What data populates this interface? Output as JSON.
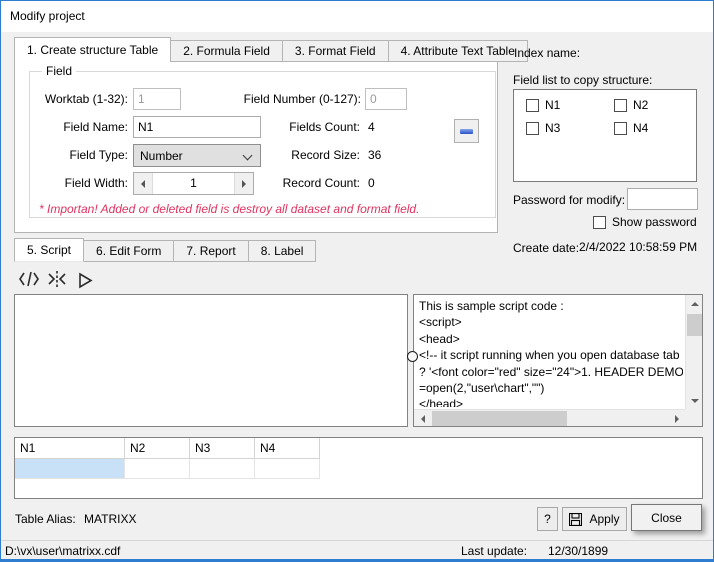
{
  "window": {
    "title": "Modify project"
  },
  "colors": {
    "accent_blue": "#2e7dd1",
    "warning_red": "#e0335f",
    "selection_blue": "#c9e1f7",
    "equals_dash_blue": "#2b50c8"
  },
  "tabs_top": {
    "items": [
      {
        "label": "1. Create structure Table",
        "active": true
      },
      {
        "label": "2. Formula Field",
        "active": false
      },
      {
        "label": "3. Format Field",
        "active": false
      },
      {
        "label": "4. Attribute Text Table",
        "active": false
      }
    ]
  },
  "field_group": {
    "legend": "Field",
    "worktab_label": "Worktab (1-32):",
    "worktab_value": "1",
    "field_number_label": "Field Number (0-127):",
    "field_number_value": "0",
    "field_name_label": "Field Name:",
    "field_name_value": "N1",
    "fields_count_label": "Fields Count:",
    "fields_count_value": "4",
    "field_type_label": "Field Type:",
    "field_type_value": "Number",
    "record_size_label": "Record Size:",
    "record_size_value": "36",
    "field_width_label": "Field Width:",
    "field_width_value": "1",
    "record_count_label": "Record Count:",
    "record_count_value": "0",
    "warning": "* Importan! Added or deleted field is destroy all dataset and format field."
  },
  "right_panel": {
    "index_name_label": "Index name:",
    "field_list_label": "Field list to copy structure:",
    "field_list": [
      {
        "label": "N1",
        "checked": false
      },
      {
        "label": "N2",
        "checked": false
      },
      {
        "label": "N3",
        "checked": false
      },
      {
        "label": "N4",
        "checked": false
      }
    ],
    "password_label": "Password for modify:",
    "password_value": "",
    "show_password_label": "Show password",
    "show_password_checked": false,
    "create_date_label": "Create date:",
    "create_date_value": "2/4/2022 10:58:59 PM"
  },
  "tabs_bottom": {
    "items": [
      {
        "label": "5. Script",
        "active": true
      },
      {
        "label": "6. Edit Form",
        "active": false
      },
      {
        "label": "7. Report",
        "active": false
      },
      {
        "label": "8. Label",
        "active": false
      }
    ]
  },
  "script": {
    "sample_lines": [
      "This is sample script code :",
      "<script>",
      "<head>",
      "<!-- it script running when you open database tab",
      "? '<font color=\"red\" size=\"24\">1. HEADER DEMO",
      "=open(2,\"user\\chart\",\"\")",
      "</head>"
    ]
  },
  "grid": {
    "columns": [
      "N1",
      "N2",
      "N3",
      "N4"
    ]
  },
  "footer": {
    "table_alias_label": "Table Alias:",
    "table_alias_value": "MATRIXX",
    "help_label": "?",
    "apply_label": "Apply",
    "close_label": "Close"
  },
  "statusbar": {
    "path": "D:\\vx\\user\\matrixx.cdf",
    "last_update_label": "Last update:",
    "last_update_value": "12/30/1899"
  }
}
